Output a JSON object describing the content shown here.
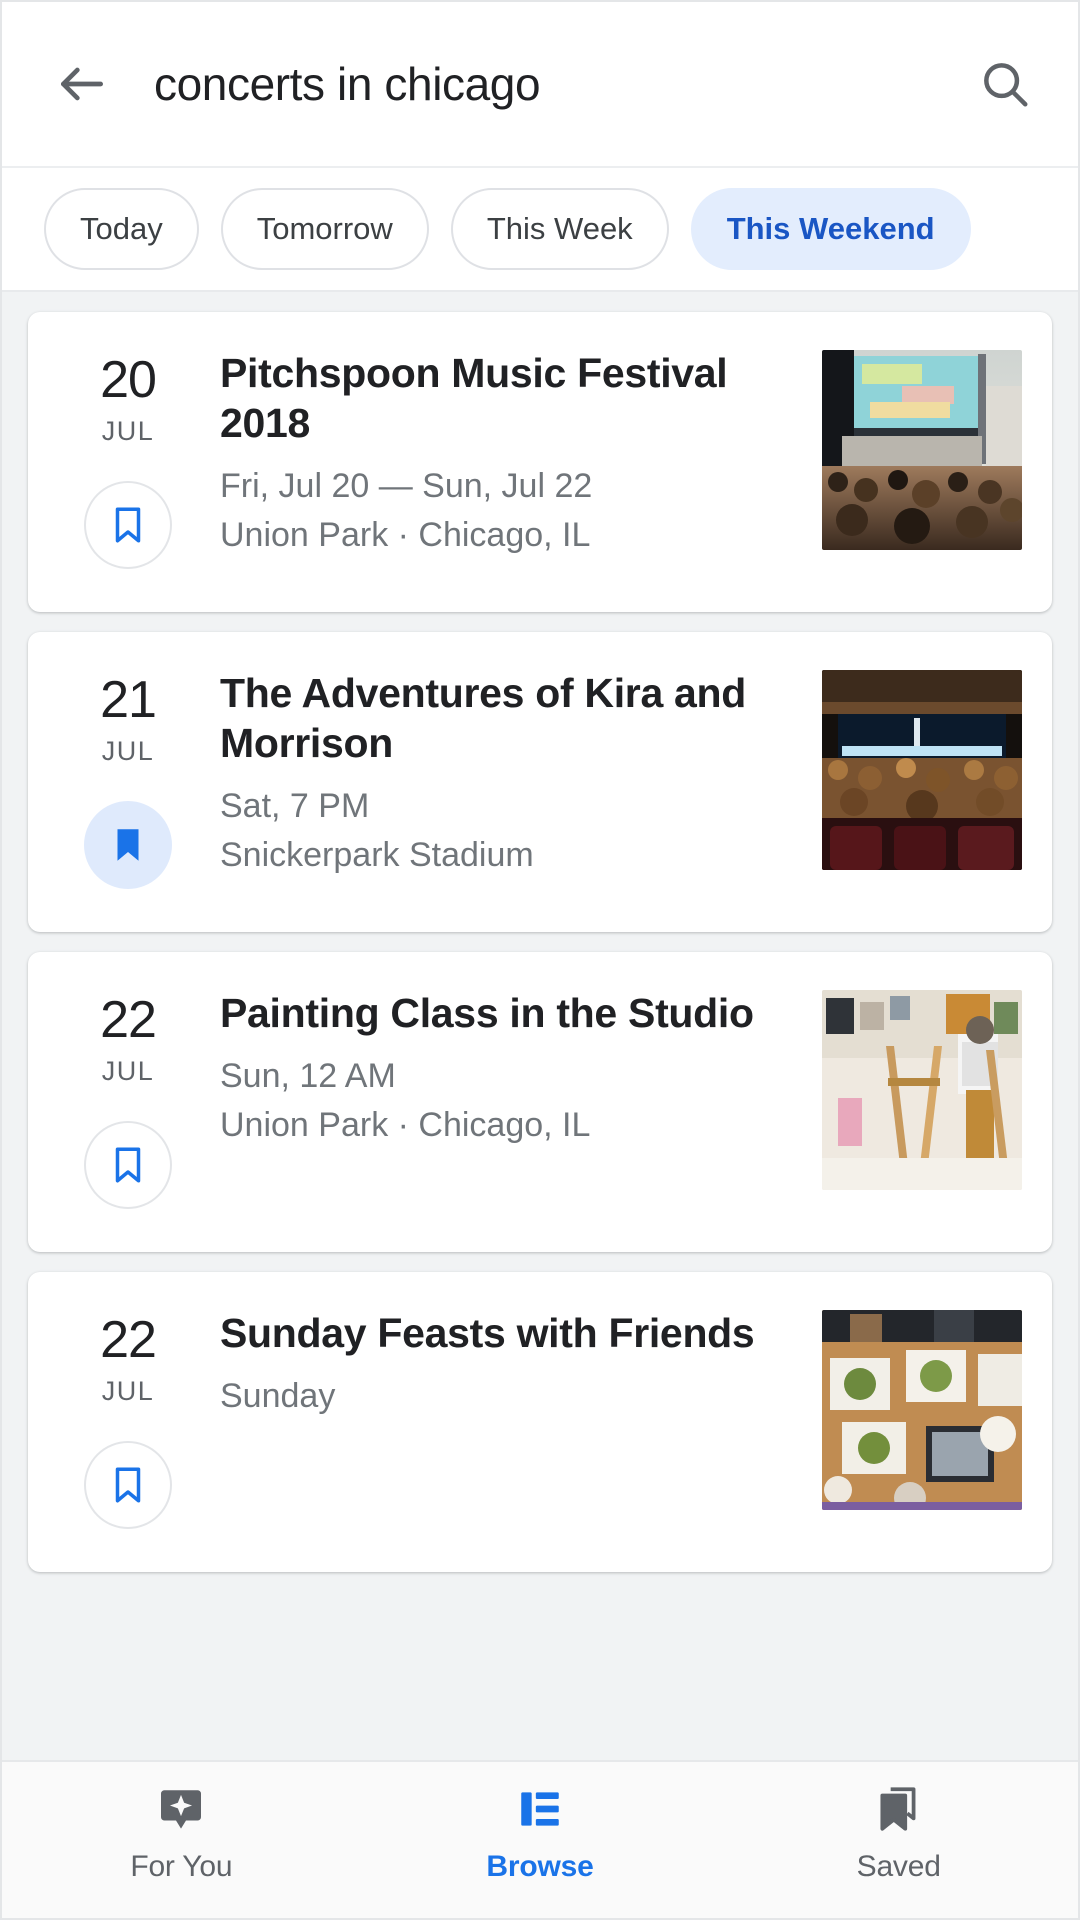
{
  "search": {
    "query": "concerts in chicago",
    "placeholder": "Search",
    "back_icon": "arrow-back-icon",
    "search_icon": "search-icon"
  },
  "filters": {
    "chips": [
      {
        "label": "Today",
        "active": false
      },
      {
        "label": "Tomorrow",
        "active": false
      },
      {
        "label": "This Week",
        "active": false
      },
      {
        "label": "This Weekend",
        "active": true
      }
    ],
    "active_color": "#1a56c4",
    "active_bg": "#e3edfd"
  },
  "events": [
    {
      "day": "20",
      "month": "JUL",
      "title": "Pitchspoon Music Festival 2018",
      "when": "Fri, Jul 20 — Sun, Jul 22",
      "where": "Union Park · Chicago, IL",
      "saved": false,
      "bookmark_icon": "bookmark-outline-icon",
      "image_alt": "outdoor-music-festival-crowd-stage"
    },
    {
      "day": "21",
      "month": "JUL",
      "title": "The Adventures of Kira and Morrison",
      "when": "Sat, 7 PM",
      "where": "Snickerpark Stadium",
      "saved": true,
      "bookmark_icon": "bookmark-filled-icon",
      "image_alt": "indoor-theater-audience-stage"
    },
    {
      "day": "22",
      "month": "JUL",
      "title": "Painting Class in the Studio",
      "when": "Sun, 12 AM",
      "where": "Union Park · Chicago, IL",
      "saved": false,
      "bookmark_icon": "bookmark-outline-icon",
      "image_alt": "art-studio-painter-easels"
    },
    {
      "day": "22",
      "month": "JUL",
      "title": "Sunday Feasts with Friends",
      "when": "Sunday",
      "where": "",
      "saved": false,
      "bookmark_icon": "bookmark-outline-icon",
      "image_alt": "dinner-table-overhead-plates-food"
    }
  ],
  "bottom_nav": {
    "items": [
      {
        "label": "For You",
        "icon": "sparkle-bubble-icon",
        "active": false
      },
      {
        "label": "Browse",
        "icon": "list-view-icon",
        "active": true
      },
      {
        "label": "Saved",
        "icon": "bookmarks-stack-icon",
        "active": false
      }
    ],
    "active_color": "#1a73e8",
    "inactive_color": "#5f6368"
  }
}
